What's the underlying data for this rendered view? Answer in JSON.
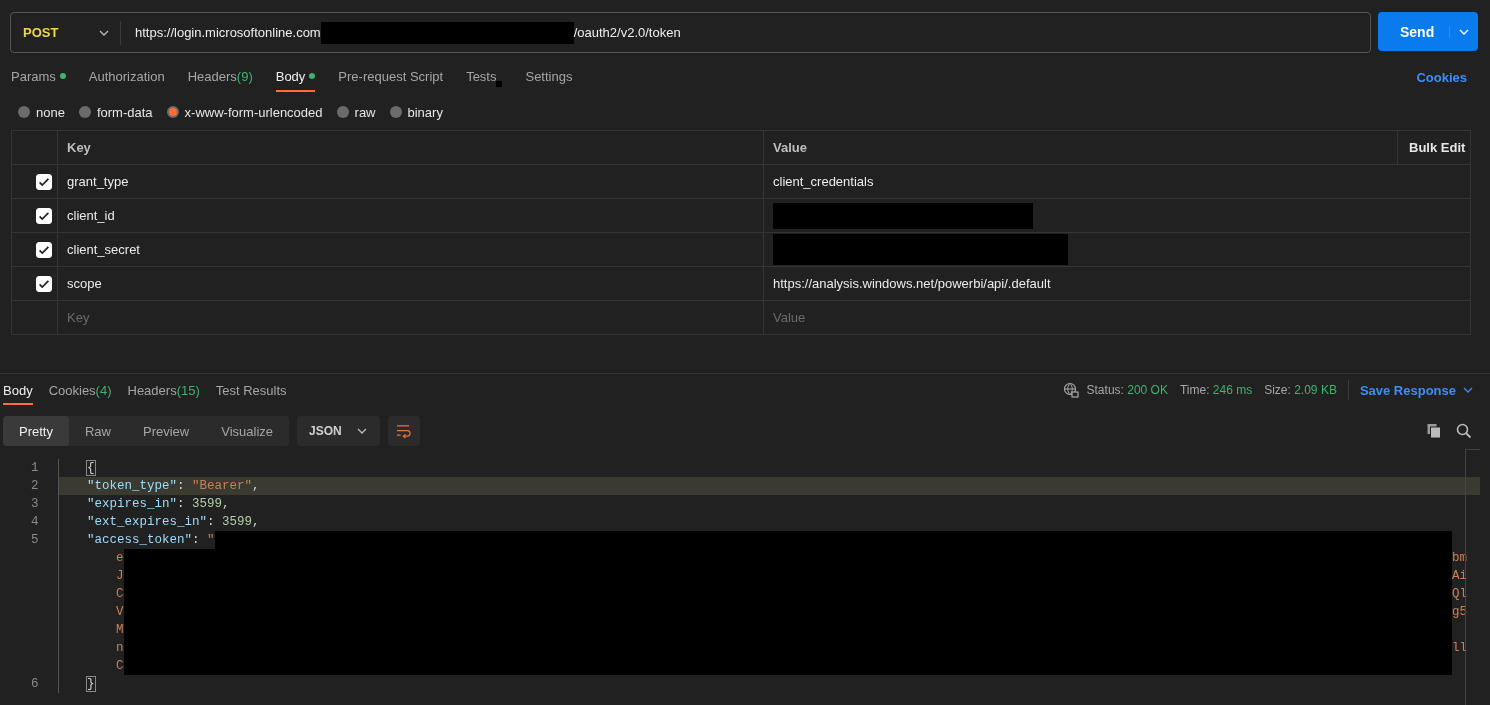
{
  "request": {
    "method": "POST",
    "url_parts": [
      {
        "kind": "text",
        "text": "https://login.microsoftonline.com"
      },
      {
        "kind": "redacted"
      },
      {
        "kind": "text",
        "text": "/oauth2/v2.0/token"
      }
    ],
    "send_label": "Send"
  },
  "request_tabs": [
    {
      "label": "Params",
      "dot": true,
      "selected": false
    },
    {
      "label": "Authorization",
      "selected": false
    },
    {
      "label": "Headers",
      "count": "(9)",
      "selected": false
    },
    {
      "label": "Body",
      "dot": true,
      "selected": true
    },
    {
      "label": "Pre-request Script",
      "selected": false
    },
    {
      "label": "Tests",
      "redacted": true,
      "selected": false
    },
    {
      "label": "Settings",
      "selected": false
    }
  ],
  "cookies_link": "Cookies",
  "body_types": [
    {
      "label": "none",
      "selected": false
    },
    {
      "label": "form-data",
      "selected": false
    },
    {
      "label": "x-www-form-urlencoded",
      "selected": true
    },
    {
      "label": "raw",
      "selected": false
    },
    {
      "label": "binary",
      "selected": false
    }
  ],
  "params_table": {
    "columns": [
      "Key",
      "Value"
    ],
    "bulk_edit": "Bulk Edit",
    "rows": [
      {
        "key": "grant_type",
        "value": "client_credentials",
        "checked": true
      },
      {
        "key": "client_id",
        "redacted": true,
        "checked": true
      },
      {
        "key": "client_secret",
        "redacted": true,
        "checked": true
      },
      {
        "key": "scope",
        "value": "https://analysis.windows.net/powerbi/api/.default",
        "checked": true
      }
    ],
    "placeholder_row": {
      "key": {
        "placeholder": "Key"
      },
      "value": {
        "placeholder": "Value"
      }
    }
  },
  "response_tabs": [
    {
      "label": "Body",
      "selected": true
    },
    {
      "label": "Cookies",
      "count": "(4)",
      "selected": false
    },
    {
      "label": "Headers",
      "count": "(15)",
      "selected": false
    },
    {
      "label": "Test Results",
      "selected": false
    }
  ],
  "response_meta": {
    "status_label": "Status:",
    "status": "200 OK",
    "time_label": "Time:",
    "time": "246 ms",
    "size_label": "Size:",
    "size": "2.09 KB",
    "save_label": "Save Response"
  },
  "view_modes": [
    {
      "label": "Pretty",
      "selected": true
    },
    {
      "label": "Raw",
      "selected": false
    },
    {
      "label": "Preview",
      "selected": false
    },
    {
      "label": "Visualize",
      "selected": false
    }
  ],
  "format": "JSON",
  "code_lines": [
    {
      "number": "1",
      "tokens": [
        {
          "kind": "punct",
          "text": "{"
        }
      ]
    },
    {
      "number": "2",
      "highlighted": true,
      "tokens": [
        {
          "kind": "key",
          "text": "\"token_type\""
        },
        {
          "kind": "punct",
          "text": ": "
        },
        {
          "kind": "string",
          "text": "\"Bearer\""
        },
        {
          "kind": "punct",
          "text": ","
        }
      ]
    },
    {
      "number": "3",
      "tokens": [
        {
          "kind": "key",
          "text": "\"expires_in\""
        },
        {
          "kind": "punct",
          "text": ": "
        },
        {
          "kind": "number",
          "text": "3599"
        },
        {
          "kind": "punct",
          "text": ","
        }
      ]
    },
    {
      "number": "4",
      "tokens": [
        {
          "kind": "key",
          "text": "\"ext_expires_in\""
        },
        {
          "kind": "punct",
          "text": ": "
        },
        {
          "kind": "number",
          "text": "3599"
        },
        {
          "kind": "punct",
          "text": ","
        }
      ]
    },
    {
      "number": "5",
      "redacted": true,
      "tokens": [
        {
          "kind": "key",
          "text": "\"access_token\""
        },
        {
          "kind": "punct",
          "text": ": "
        },
        {
          "kind": "string",
          "text": "\""
        }
      ]
    },
    {
      "continuation": true,
      "redacted": true,
      "left": "e",
      "right": "bm"
    },
    {
      "continuation": true,
      "redacted": true,
      "left": "J",
      "right": "Ai"
    },
    {
      "continuation": true,
      "redacted": true,
      "left": "C",
      "right": "Ql"
    },
    {
      "continuation": true,
      "redacted": true,
      "left": "V",
      "right": "g5"
    },
    {
      "continuation": true,
      "redacted": true,
      "left": "M"
    },
    {
      "continuation": true,
      "redacted": true,
      "left": "n",
      "right": "ll"
    },
    {
      "continuation": true,
      "redacted": true,
      "left": "C"
    },
    {
      "number": "6",
      "tokens": [
        {
          "kind": "punct",
          "text": "}"
        }
      ]
    }
  ]
}
